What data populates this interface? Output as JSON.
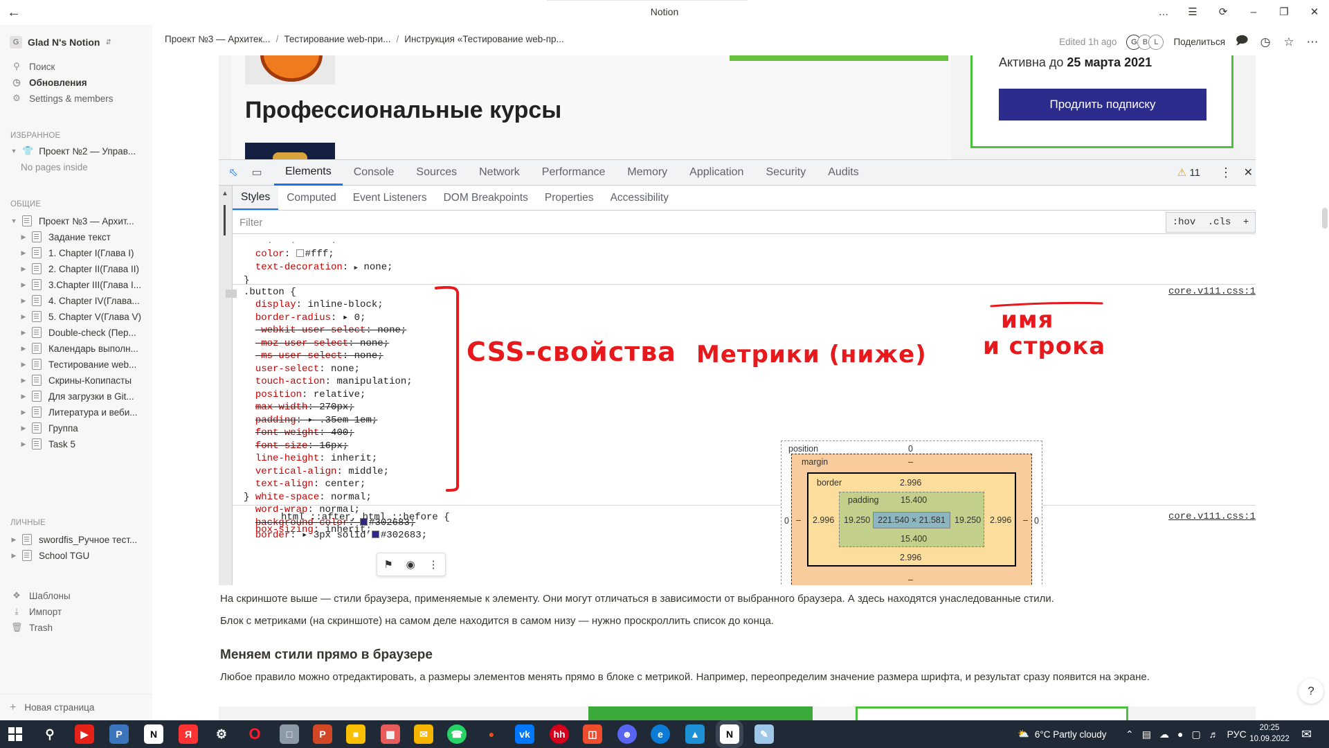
{
  "window": {
    "title": "Notion"
  },
  "sidebar": {
    "workspace_badge": "G",
    "workspace_name": "Glad N's Notion",
    "nav": [
      {
        "label": "Поиск",
        "icon": "search-icon"
      },
      {
        "label": "Обновления",
        "icon": "clock-icon"
      },
      {
        "label": "Settings & members",
        "icon": "gear-icon"
      }
    ],
    "favorites_title": "ИЗБРАННОЕ",
    "favorites": [
      {
        "label": "Проект №2 — Управ...",
        "icon": "shirt-icon"
      }
    ],
    "favorites_empty": "No pages inside",
    "shared_title": "ОБЩИЕ",
    "shared_root": "Проект №3 — Архит...",
    "shared_children": [
      "Задание текст",
      "1. Chapter I(Глава I)",
      "2. Chapter II(Глава II)",
      "3.Chapter III(Глава I...",
      "4. Chapter IV(Глава...",
      "5. Chapter V(Глава V)",
      "Double-check (Пер...",
      "Календарь выполн...",
      "Тестирование web...",
      "Скрины-Копипасты",
      "Для загрузки в Git...",
      "Литература и веби...",
      "Группа",
      "Task 5"
    ],
    "private_title": "ЛИЧНЫЕ",
    "private": [
      "swordfis_Ручное тест...",
      "School TGU"
    ],
    "bottom": [
      {
        "label": "Шаблоны",
        "icon": "templates-icon"
      },
      {
        "label": "Импорт",
        "icon": "download-icon"
      },
      {
        "label": "Trash",
        "icon": "trash-icon"
      }
    ],
    "new_page": "Новая страница"
  },
  "topbar": {
    "crumbs": [
      "Проект №3 — Архитек...",
      "Тестирование web-при...",
      "Инструкция «Тестирование web-пр..."
    ],
    "edited": "Edited 1h ago",
    "avatars": [
      "G",
      "B",
      "L"
    ],
    "share": "Поделиться"
  },
  "web": {
    "heading": "Профессиональные курсы",
    "active_prefix": "Активна до ",
    "active_date": "25 марта 2021",
    "renew_button": "Продлить подписку"
  },
  "devtools": {
    "tabs": [
      "Elements",
      "Console",
      "Sources",
      "Network",
      "Performance",
      "Memory",
      "Application",
      "Security",
      "Audits"
    ],
    "selected_tab": "Elements",
    "warnings": "11",
    "subtabs": [
      "Styles",
      "Computed",
      "Event Listeners",
      "DOM Breakpoints",
      "Properties",
      "Accessibility"
    ],
    "filter_placeholder": "Filter",
    "hov": ":hov",
    "cls": ".cls",
    "source_link": "core.v111.css:1",
    "source_link2": "core.v111.css:1",
    "prev_rule": [
      {
        "prop": "color",
        "val": "#fff",
        "swatch": "#ffffff"
      },
      {
        "prop": "text-decoration",
        "val": "none",
        "arrow": true
      }
    ],
    "selector": ".button {",
    "declarations": [
      {
        "prop": "display",
        "val": "inline-block;",
        "struck": false
      },
      {
        "prop": "border-radius",
        "val": "▸ 0;",
        "struck": false
      },
      {
        "prop": "-webkit-user-select",
        "val": "none;",
        "struck": true
      },
      {
        "prop": "-moz-user-select",
        "val": "none;",
        "struck": true
      },
      {
        "prop": "-ms-user-select",
        "val": "none;",
        "struck": true
      },
      {
        "prop": "user-select",
        "val": "none;",
        "struck": false
      },
      {
        "prop": "touch-action",
        "val": "manipulation;",
        "struck": false
      },
      {
        "prop": "position",
        "val": "relative;",
        "struck": false
      },
      {
        "prop": "max-width",
        "val": "270px;",
        "struck": true
      },
      {
        "prop": "padding",
        "val": "▸ .35em 1em;",
        "struck": true
      },
      {
        "prop": "font-weight",
        "val": "400;",
        "struck": true
      },
      {
        "prop": "font-size",
        "val": "16px;",
        "struck": true
      },
      {
        "prop": "line-height",
        "val": "inherit;",
        "struck": false
      },
      {
        "prop": "vertical-align",
        "val": "middle;",
        "struck": false
      },
      {
        "prop": "text-align",
        "val": "center;",
        "struck": false
      },
      {
        "prop": "white-space",
        "val": "normal;",
        "struck": false
      },
      {
        "prop": "word-wrap",
        "val": "normal;",
        "struck": false
      },
      {
        "prop": "background-color",
        "val": "#302683;",
        "struck": true,
        "swatch": "#302683"
      },
      {
        "prop": "border",
        "val": "▸ 3px solid ",
        "struck": false,
        "swatch": "#302683",
        "tail": "#302683;"
      }
    ],
    "next_selector": "html ::after, html ::before {",
    "next_decl": {
      "prop": "box-sizing",
      "val": "inherit;"
    },
    "box_model": {
      "position_label": "position",
      "position_val": "0",
      "margin_label": "margin",
      "margin_val": "–",
      "border_label": "border",
      "border_val": "2.996",
      "padding_label": "padding",
      "padding_val": "15.400",
      "content": "221.540 × 21.581",
      "padding_side": "19.250",
      "border_side": "2.996",
      "margin_side": "–",
      "position_side": "0"
    }
  },
  "annotations": {
    "css_props": "CSS-свойства",
    "metrics": "Метрики (ниже)",
    "name_line1": "имя",
    "name_line2": "и строка"
  },
  "article": {
    "p1": "На скриншоте выше — стили браузера, применяемые к элементу. Они могут отличаться в зависимости от выбранного браузера. А здесь находятся унаследованные стили.",
    "p2": "Блок с метриками (на скриншоте) на самом деле находится в самом низу — нужно проскроллить список до конца.",
    "h2": "Меняем стили прямо в браузере",
    "p3": "Любое правило можно отредактировать, а размеры элементов менять прямо в блоке с метрикой. Например, переопределим значение размера шрифта, и результат сразу появится на экране.",
    "help": "?"
  },
  "taskbar": {
    "weather": "6°C  Partly cloudy",
    "lang": "РУС",
    "time": "20:25",
    "date": "10.09.2022"
  },
  "colors": {
    "notion_bg": "#ffffff",
    "sidebar_bg": "#f7f7f5",
    "annotation_red": "#e8191c",
    "devtools_blue": "#1a73e8",
    "taskbar_bg": "#1f2a36"
  }
}
